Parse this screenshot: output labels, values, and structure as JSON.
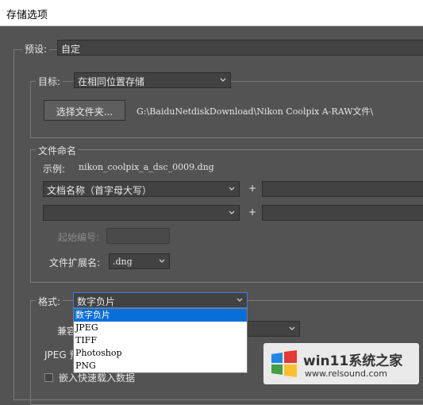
{
  "window": {
    "title": "存储选项"
  },
  "preset": {
    "label": "预设:",
    "value": "自定"
  },
  "destination": {
    "label": "目标:",
    "value": "在相同位置存储",
    "choose_button": "选择文件夹...",
    "path": "G:\\BaiduNetdiskDownload\\Nikon Coolpix A-RAW文件\\"
  },
  "file_naming": {
    "group_label": "文件命名",
    "example_label": "示例:",
    "example_value": "nikon_coolpix_a_dsc_0009.dng",
    "row1_select": "文档名称（首字母大写）",
    "row1_plus": "+",
    "row2_select": "",
    "row2_plus": "+",
    "start_number_label": "起始编号:",
    "start_number_value": "",
    "extension_label": "文件扩展名:",
    "extension_value": ".dng"
  },
  "format": {
    "label": "格式:",
    "value": "数字负片",
    "options": [
      "数字负片",
      "JPEG",
      "TIFF",
      "Photoshop",
      "PNG"
    ],
    "selected_index": 0
  },
  "partial_labels": {
    "compat_label": "兼容",
    "jpeg_label": "JPEG 预",
    "embed_label": "嵌入快速载入数据"
  },
  "watermark": {
    "text": "win11系统之家",
    "url": "www.relsound.com"
  },
  "colors": {
    "highlight": "#0a6ed8",
    "panel": "#535353",
    "field": "#424242"
  }
}
